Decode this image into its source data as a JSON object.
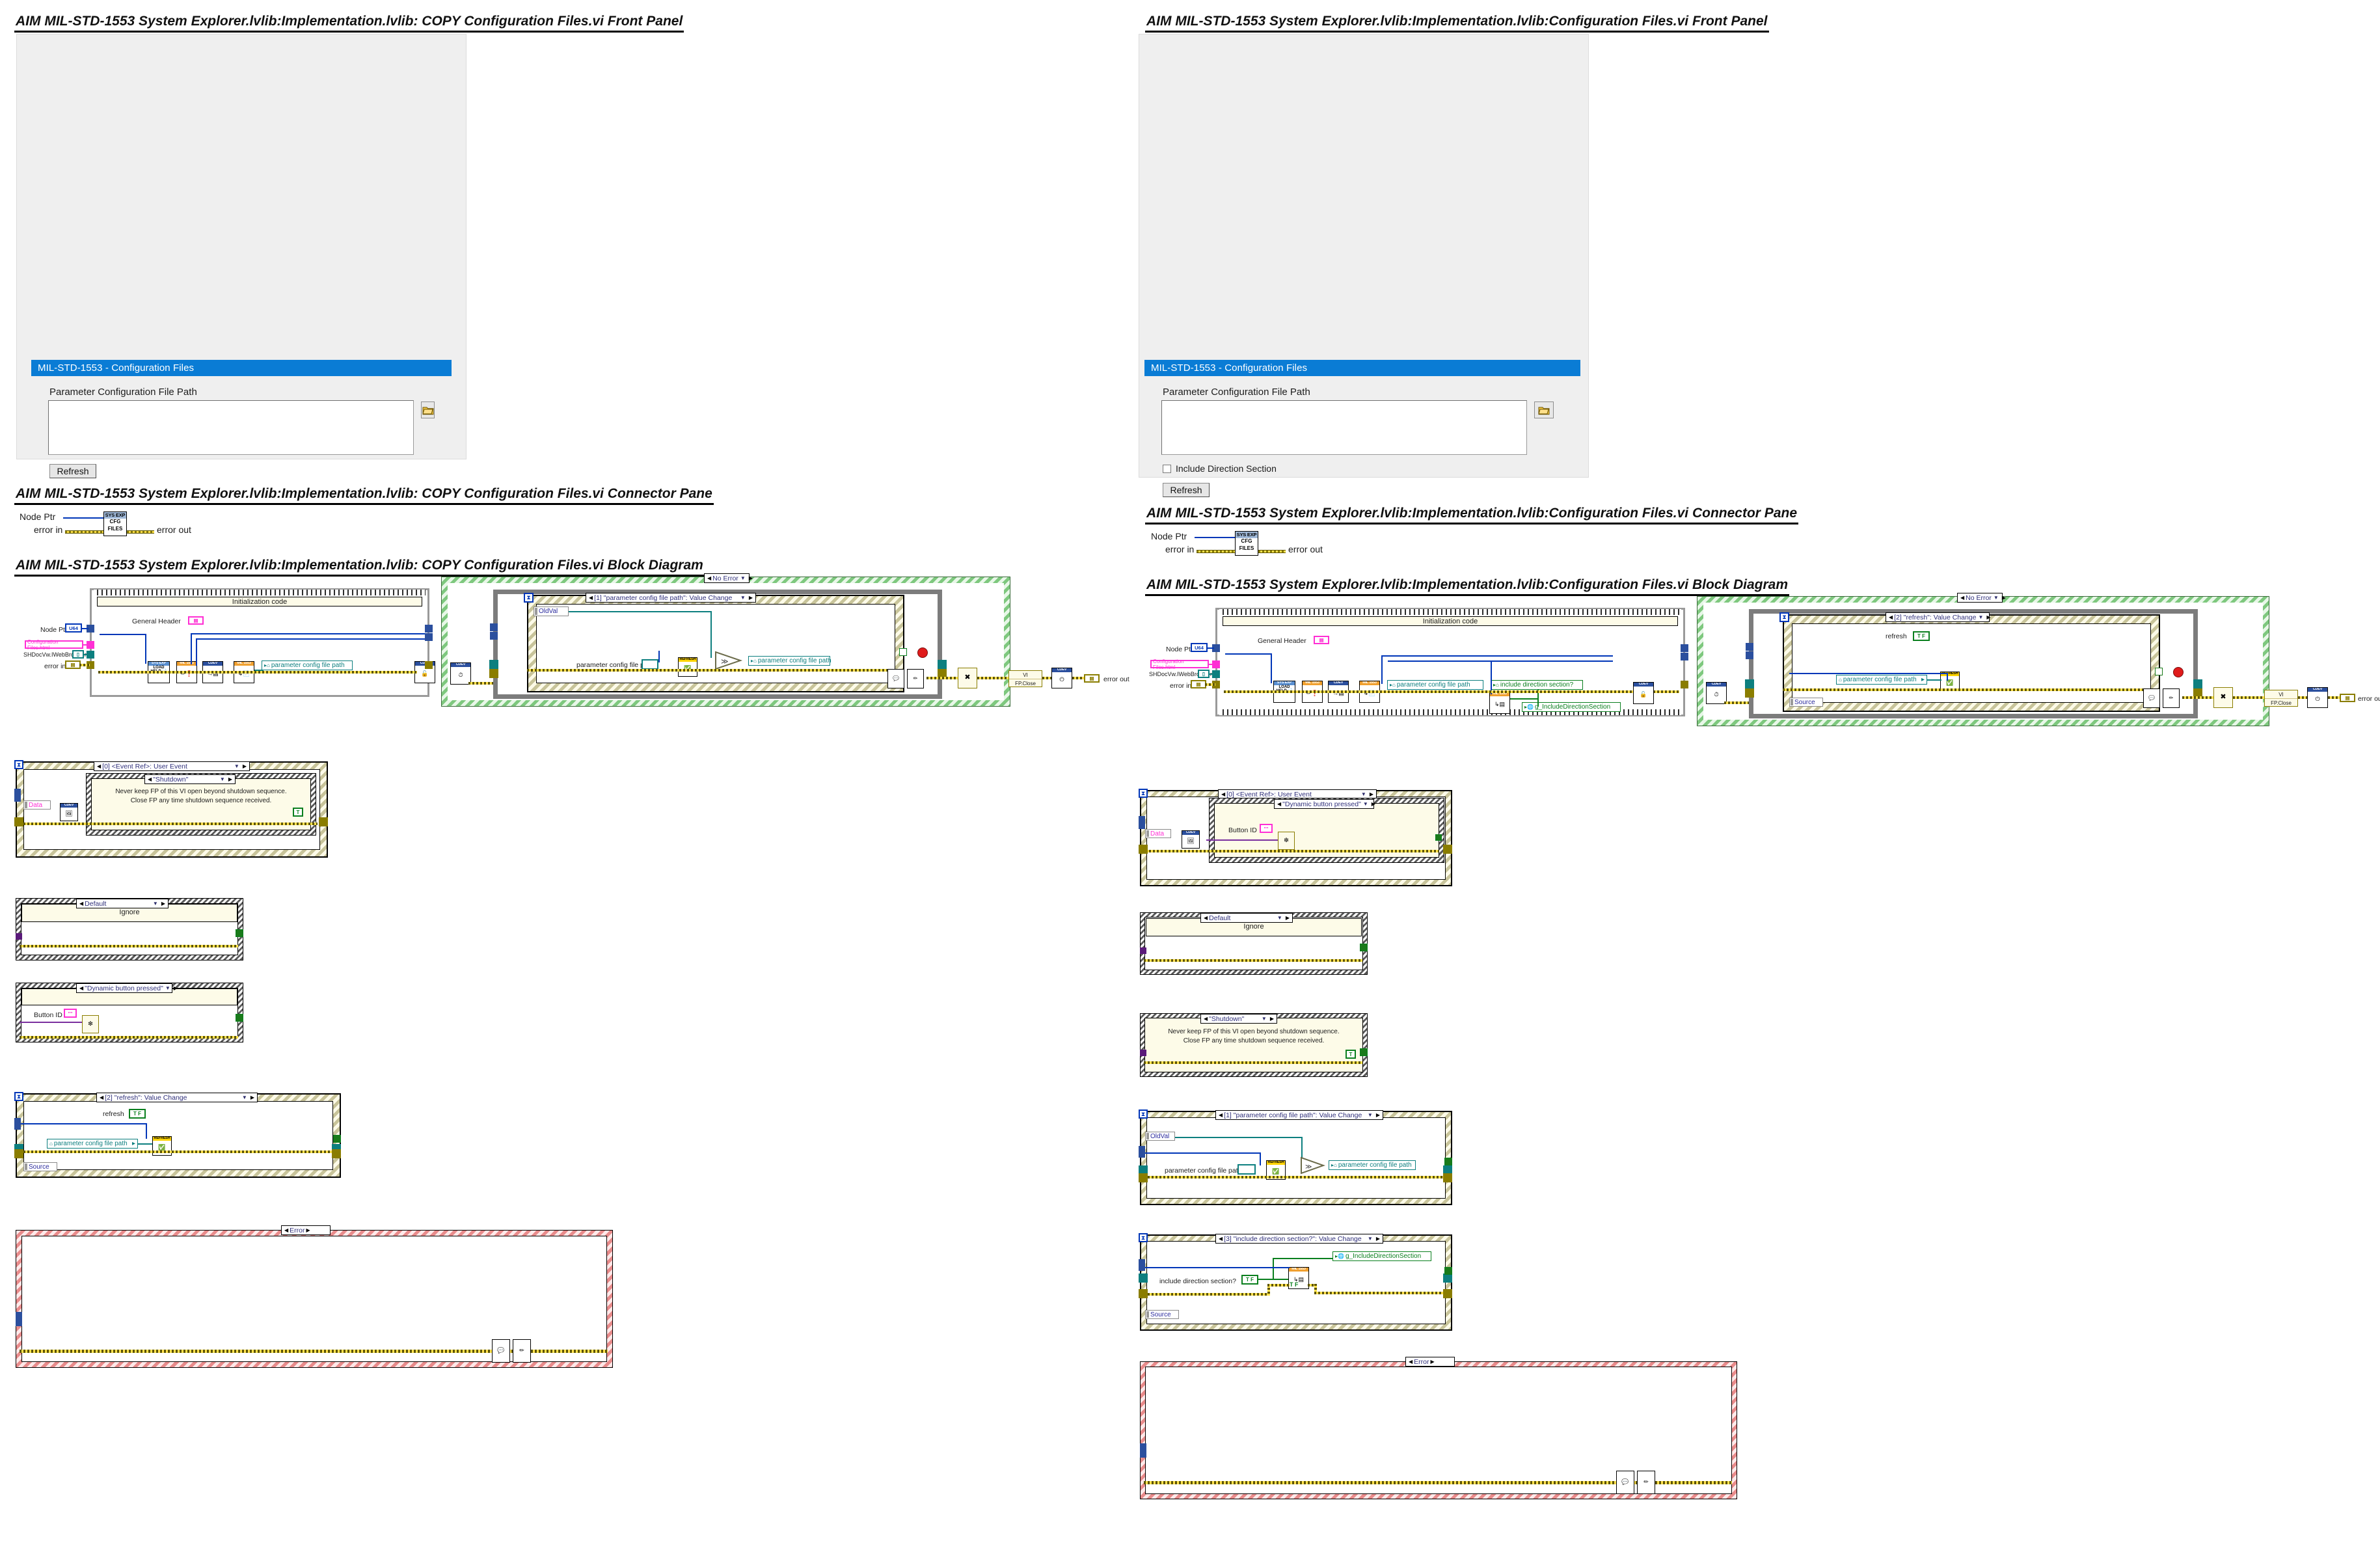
{
  "document": {
    "type": "LabVIEW VI Documentation Comparison",
    "columns": 2
  },
  "left": {
    "front_panel_heading": "AIM MIL-STD-1553 System Explorer.lvlib:Implementation.lvlib:  COPY  Configuration Files.vi Front Panel",
    "connector_pane_heading": "AIM MIL-STD-1553 System Explorer.lvlib:Implementation.lvlib:  COPY  Configuration Files.vi Connector Pane",
    "block_diagram_heading": "AIM MIL-STD-1553 System Explorer.lvlib:Implementation.lvlib:  COPY  Configuration Files.vi Block Diagram",
    "front_panel": {
      "window_title": "MIL-STD-1553 - Configuration Files",
      "path_label": "Parameter Configuration File Path",
      "path_value": "",
      "browse_icon": "folder-icon",
      "refresh_button": "Refresh",
      "has_include_direction_checkbox": false
    },
    "connector_pane": {
      "inputs": [
        "Node Ptr",
        "error in"
      ],
      "outputs": [
        "error out"
      ],
      "icon_lines": [
        "SYS EXP",
        "CFG",
        "FILES"
      ]
    },
    "block_diagram": {
      "init_frame_title": "Initialization code",
      "general_header_label": "General Header",
      "terminals": {
        "node_ptr": "Node Ptr",
        "node_ptr_type": "U64",
        "html_constant": "Configuration Files.html",
        "web_browser": "SHDocVw.IWebBrowser",
        "error_in": "error in",
        "error_out": "error out"
      },
      "subvis": {
        "load_help": [
          "SYS EXP",
          "LOAD",
          "HELP"
        ],
        "mil_1553": "MIL 1553",
        "cdev": "CDEV",
        "refresh": "REFRESH"
      },
      "param_path_property": "parameter config file path",
      "outer_case_label": "No Error",
      "reg_events": {
        "title": "Reg Events",
        "row2": "User Event"
      },
      "event_case_label": "[1] \"parameter config file path\": Value Change",
      "old_val_label": "OldVal",
      "param_path_control": "parameter config file path",
      "fp_close": {
        "line1": "VI",
        "line2": "FP.Close"
      },
      "error_handler_icons": [
        "error-query-icon",
        "error-number-icon"
      ]
    },
    "cases": [
      {
        "id": "event-ref-user-event",
        "label": "[0] <Event Ref>: User Event",
        "data_label": "Data",
        "inner_label": "\"Shutdown\"",
        "comment_line1": "Never keep FP of this VI open beyond shutdown sequence.",
        "comment_line2": "Close FP any time shutdown sequence received.",
        "true_constant": "T"
      },
      {
        "id": "default-ignore",
        "label": "Default",
        "comment": "Ignore"
      },
      {
        "id": "dynamic-button-pressed",
        "label": "\"Dynamic button pressed\"",
        "button_id_label": "Button ID"
      },
      {
        "id": "refresh-value-change",
        "label": "[2] \"refresh\": Value Change",
        "refresh_label": "refresh",
        "refresh_value": "T F",
        "param_path_property": "parameter config file path",
        "source_label": "Source"
      },
      {
        "id": "error-case",
        "label": "Error"
      }
    ]
  },
  "right": {
    "front_panel_heading": "AIM MIL-STD-1553 System Explorer.lvlib:Implementation.lvlib:Configuration Files.vi Front Panel",
    "connector_pane_heading": "AIM MIL-STD-1553 System Explorer.lvlib:Implementation.lvlib:Configuration Files.vi Connector Pane",
    "block_diagram_heading": "AIM MIL-STD-1553 System Explorer.lvlib:Implementation.lvlib:Configuration Files.vi Block Diagram",
    "front_panel": {
      "window_title": "MIL-STD-1553 - Configuration Files",
      "path_label": "Parameter Configuration File Path",
      "path_value": "",
      "browse_icon": "folder-icon",
      "checkbox_label": "Include Direction Section",
      "checkbox_checked": false,
      "refresh_button": "Refresh",
      "has_include_direction_checkbox": true
    },
    "connector_pane": {
      "inputs": [
        "Node Ptr",
        "error in"
      ],
      "outputs": [
        "error out"
      ],
      "icon_lines": [
        "SYS EXP",
        "CFG",
        "FILES"
      ]
    },
    "block_diagram": {
      "init_frame_title": "Initialization code",
      "general_header_label": "General Header",
      "terminals": {
        "node_ptr": "Node Ptr",
        "node_ptr_type": "U64",
        "html_constant": "Configuration Files.html",
        "web_browser": "SHDocVw.IWebBrowser",
        "error_in": "error in",
        "error_out": "error out"
      },
      "param_path_property": "parameter config file path",
      "include_dir_property": "include direction section?",
      "global_include_dir": "g_IncludeDirectionSection",
      "outer_case_label": "No Error",
      "reg_events": {
        "title": "Reg Events",
        "row2": "User Event"
      },
      "event_case_label": "[2] \"refresh\": Value Change",
      "refresh_label": "refresh",
      "refresh_value": "T F",
      "param_path_property_inner": "parameter config file path",
      "source_label": "Source",
      "fp_close": {
        "line1": "VI",
        "line2": "FP.Close"
      }
    },
    "cases": [
      {
        "id": "event-ref-user-event",
        "label": "[0] <Event Ref>: User Event",
        "data_label": "Data",
        "inner_label": "\"Dynamic button pressed\"",
        "button_id_label": "Button ID"
      },
      {
        "id": "default-ignore",
        "label": "Default",
        "comment": "Ignore"
      },
      {
        "id": "shutdown",
        "label": "\"Shutdown\"",
        "comment_line1": "Never keep FP of this VI open beyond shutdown sequence.",
        "comment_line2": "Close FP any time shutdown sequence received.",
        "true_constant": "T"
      },
      {
        "id": "param-config-file-path-value-change",
        "label": "[1] \"parameter config file path\": Value Change",
        "old_val_label": "OldVal",
        "param_path_control": "parameter config file path",
        "param_path_property": "parameter config file path"
      },
      {
        "id": "include-direction-section-value-change",
        "label": "[3] \"include direction section?\": Value Change",
        "include_dir_label": "include direction section?",
        "include_dir_value": "T F",
        "global_include_dir": "g_IncludeDirectionSection",
        "source_label": "Source",
        "tf_constant": "T F"
      },
      {
        "id": "error-case",
        "label": "Error"
      }
    ]
  },
  "colors": {
    "titlebar": "#0a7cd5",
    "blue_wire": "#0036b8",
    "error_wire": "#ffe24d",
    "teal": "#0d7f7f",
    "pink": "#ff2fd4",
    "green": "#0a7f1e"
  }
}
